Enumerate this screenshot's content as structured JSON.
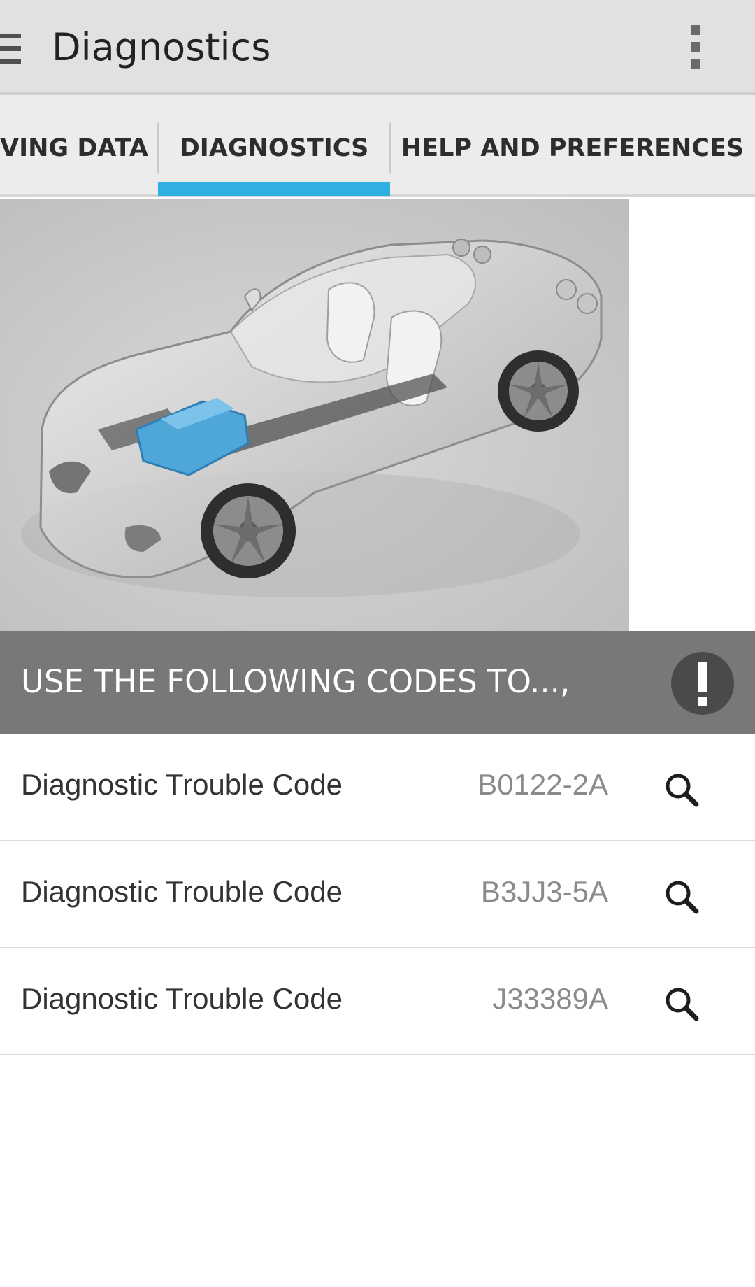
{
  "appbar": {
    "title": "Diagnostics"
  },
  "tabs": [
    {
      "label": "VING DATA"
    },
    {
      "label": "DIAGNOSTICS"
    },
    {
      "label": "HELP AND PREFERENCES"
    }
  ],
  "tabs_active_index": 1,
  "colors": {
    "accent": "#30b0e0",
    "engine": "#4fa6d9",
    "banner": "#787878"
  },
  "banner": {
    "text": "USE THE FOLLOWING CODES TO...,",
    "icon": "alert-icon"
  },
  "codes": [
    {
      "label": "Diagnostic Trouble Code",
      "code": "B0122-2A",
      "icon": "search-icon"
    },
    {
      "label": "Diagnostic Trouble Code",
      "code": "B3JJ3-5A",
      "icon": "search-icon"
    },
    {
      "label": "Diagnostic Trouble Code",
      "code": "J33389A",
      "icon": "search-icon"
    }
  ]
}
